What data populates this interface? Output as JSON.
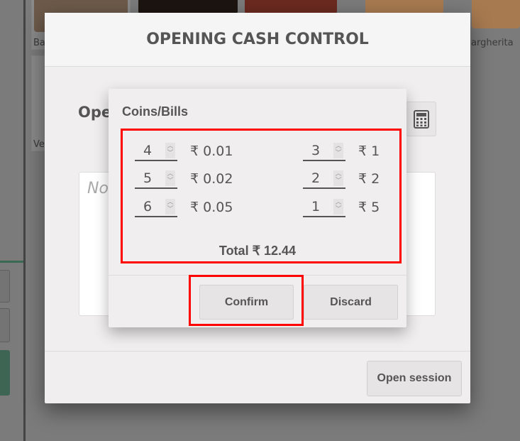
{
  "background": {
    "products": [
      "Ba",
      "argherita",
      "Ve"
    ]
  },
  "modal": {
    "title": "OPENING CASH CONTROL",
    "opening_label": "Ope",
    "notes_placeholder": "No",
    "open_session_label": "Open session",
    "calculator_icon": "calculator-icon"
  },
  "popup": {
    "title": "Coins/Bills",
    "left": [
      {
        "qty": "4",
        "denom": "₹ 0.01"
      },
      {
        "qty": "5",
        "denom": "₹ 0.02"
      },
      {
        "qty": "6",
        "denom": "₹ 0.05"
      }
    ],
    "right": [
      {
        "qty": "3",
        "denom": "₹ 1"
      },
      {
        "qty": "2",
        "denom": "₹ 2"
      },
      {
        "qty": "1",
        "denom": "₹ 5"
      }
    ],
    "total": "Total ₹ 12.44",
    "confirm_label": "Confirm",
    "discard_label": "Discard"
  },
  "colors": {
    "highlight": "#ff0000"
  }
}
